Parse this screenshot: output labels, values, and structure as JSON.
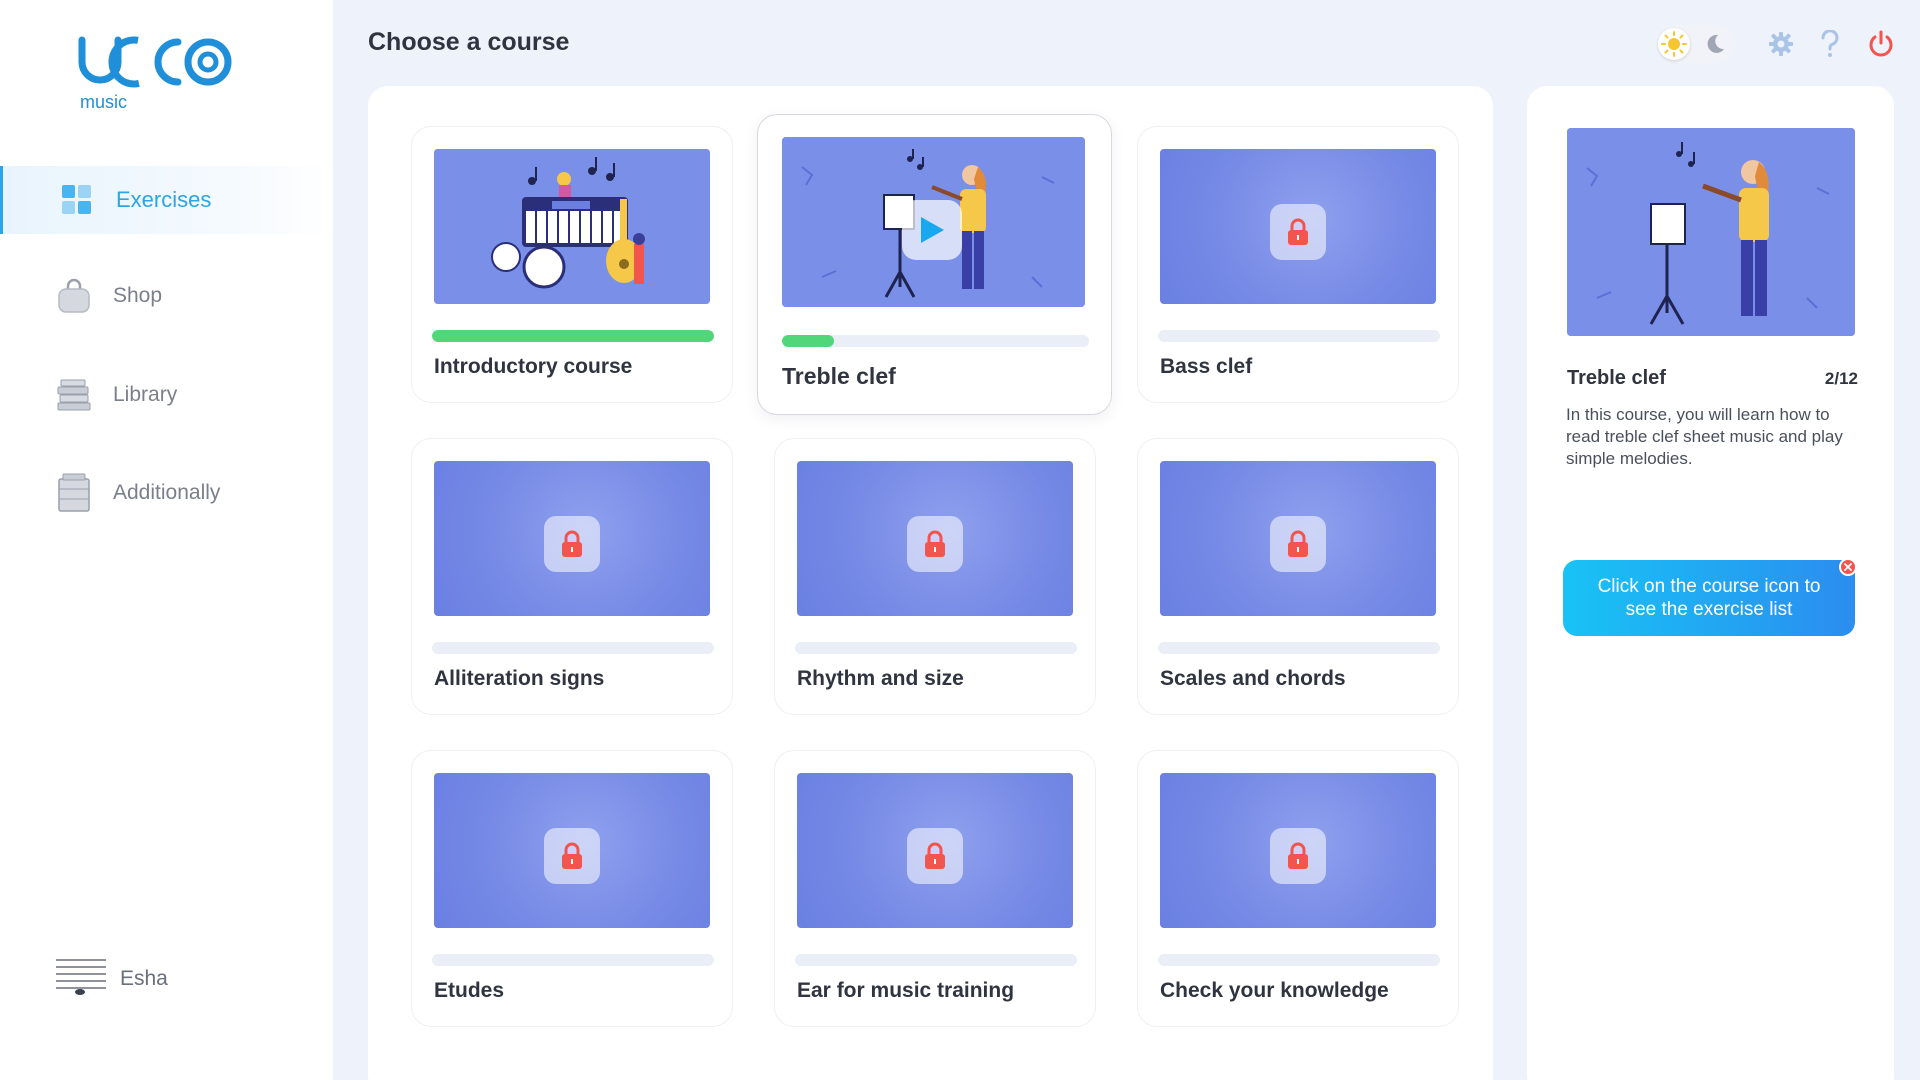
{
  "app": {
    "logo_sub": "music"
  },
  "sidebar": {
    "items": [
      {
        "label": "Exercises",
        "icon": "grid-icon"
      },
      {
        "label": "Shop",
        "icon": "bag-icon"
      },
      {
        "label": "Library",
        "icon": "books-icon"
      },
      {
        "label": "Additionally",
        "icon": "archive-icon"
      }
    ],
    "user": {
      "name": "Esha"
    }
  },
  "header": {
    "title": "Choose a course"
  },
  "courses": [
    {
      "title": "Introductory course",
      "progress": 1.0,
      "locked": false
    },
    {
      "title": "Treble clef",
      "progress": 0.17,
      "locked": false,
      "selected": true
    },
    {
      "title": "Bass clef",
      "progress": 0,
      "locked": true
    },
    {
      "title": "Alliteration signs",
      "progress": 0,
      "locked": true
    },
    {
      "title": "Rhythm and size",
      "progress": 0,
      "locked": true
    },
    {
      "title": "Scales and chords",
      "progress": 0,
      "locked": true
    },
    {
      "title": "Etudes",
      "progress": 0,
      "locked": true
    },
    {
      "title": "Ear for music training",
      "progress": 0,
      "locked": true
    },
    {
      "title": "Check your knowledge",
      "progress": 0,
      "locked": true
    }
  ],
  "details": {
    "title": "Treble clef",
    "count": "2/12",
    "description": "In this course, you will learn how to read treble clef sheet music and play simple melodies."
  },
  "tip": {
    "text": "Click on the course icon to see the exercise list"
  },
  "colors": {
    "accent": "#2aa5e6",
    "progress": "#52d67a",
    "thumb": "#7a8fe8",
    "lock": "#f2544e"
  }
}
